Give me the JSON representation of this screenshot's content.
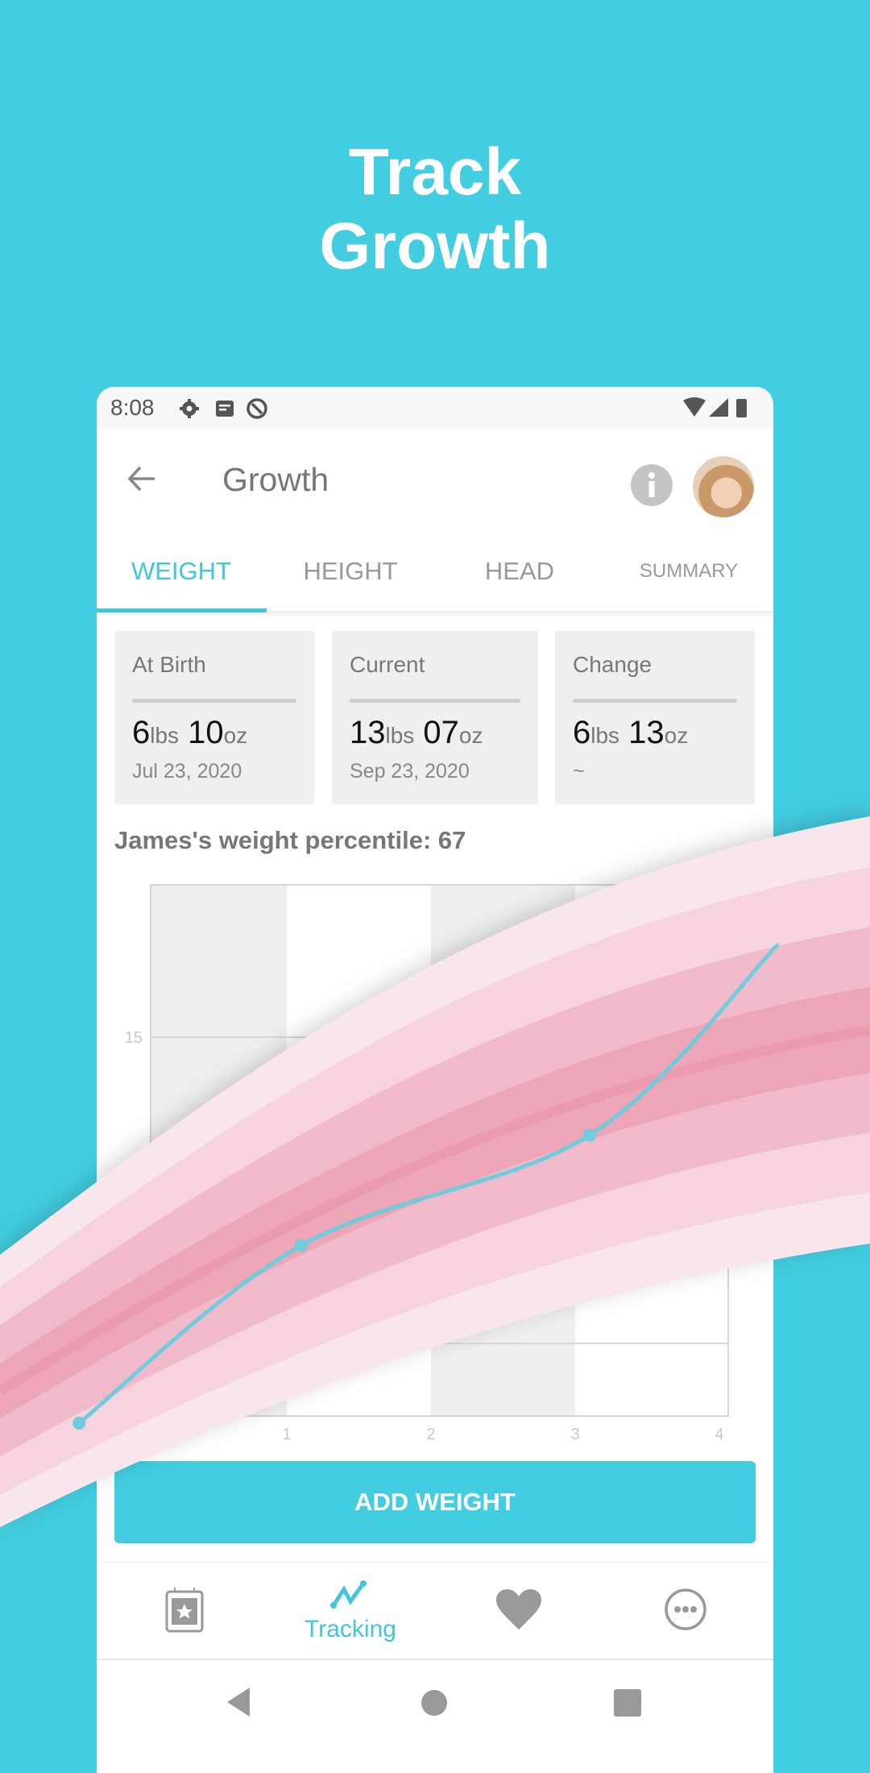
{
  "headline": {
    "line1": "Track",
    "line2": "Growth"
  },
  "status_bar": {
    "time": "8:08",
    "icons": [
      "gear-icon",
      "notes-icon",
      "q-icon",
      "wifi-icon",
      "signal-icon",
      "battery-icon"
    ]
  },
  "app_bar": {
    "title": "Growth",
    "back_icon": "arrow-left-icon",
    "info_icon": "info-icon"
  },
  "tabs": [
    {
      "label": "WEIGHT",
      "active": true
    },
    {
      "label": "HEIGHT"
    },
    {
      "label": "HEAD"
    },
    {
      "label": "SUMMARY"
    }
  ],
  "cards": [
    {
      "label": "At Birth",
      "lbs": "6",
      "oz": "10",
      "date": "Jul 23, 2020"
    },
    {
      "label": "Current",
      "lbs": "13",
      "oz": "07",
      "date": "Sep 23, 2020"
    },
    {
      "label": "Change",
      "lbs": "6",
      "oz": "13",
      "date": "~"
    }
  ],
  "units": {
    "lbs": "lbs",
    "oz": "oz"
  },
  "percentile_text": "James's weight percentile: 67",
  "chart_data": {
    "type": "line",
    "x_ticks": [
      "1",
      "2",
      "3",
      "4"
    ],
    "y_ticks": [
      "15"
    ],
    "xlim": [
      0,
      4
    ],
    "grid": true,
    "points": [
      [
        -0.44,
        8.7
      ],
      [
        1.1,
        11.6
      ],
      [
        3.1,
        13.4
      ],
      [
        4.4,
        16.5
      ]
    ],
    "line_color": "#6ECCDC",
    "band_colors": [
      "#F9E6EC",
      "#F6D3DD",
      "#F1BACA",
      "#EDA5B8",
      "#EB9AB0"
    ]
  },
  "add_button": "ADD WEIGHT",
  "bottom_nav": [
    {
      "icon": "calendar-star-icon"
    },
    {
      "icon": "tracking-icon",
      "label": "Tracking",
      "active": true
    },
    {
      "icon": "heart-icon"
    },
    {
      "icon": "more-icon"
    }
  ],
  "colors": {
    "background": "#42CDE0",
    "accent": "#42C6DD"
  }
}
